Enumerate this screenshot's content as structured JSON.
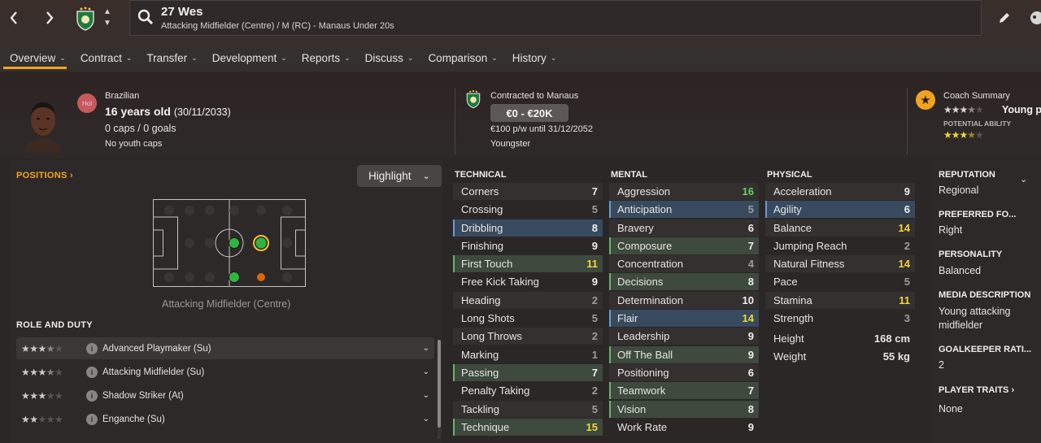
{
  "header": {
    "title": "27 Wes",
    "subtitle": "Attacking Midfielder (Centre) / M (RC) - Manaus Under 20s"
  },
  "tabs": [
    {
      "label": "Overview"
    },
    {
      "label": "Contract"
    },
    {
      "label": "Transfer"
    },
    {
      "label": "Development"
    },
    {
      "label": "Reports"
    },
    {
      "label": "Discuss"
    },
    {
      "label": "Comparison"
    },
    {
      "label": "History"
    }
  ],
  "profile": {
    "position_badge": "Hol",
    "nationality": "Brazilian",
    "age": "16 years old",
    "dob": "(30/11/2033)",
    "caps": "0 caps / 0 goals",
    "youth_caps": "No youth caps"
  },
  "contract": {
    "club": "Contracted to Manaus",
    "value": "€0 - €20K",
    "wage": "€100 p/w until 31/12/2052",
    "status": "Youngster"
  },
  "coach": {
    "label": "Coach Summary",
    "current_stars": 3.5,
    "summary_text": "Young p",
    "potential_label": "POTENTIAL ABILITY",
    "potential_stars": 3.5
  },
  "positions": {
    "heading": "POSITIONS",
    "highlight_label": "Highlight",
    "position_name": "Attacking Midfielder (Centre)"
  },
  "roles": {
    "heading": "ROLE AND DUTY",
    "items": [
      {
        "name": "Advanced Playmaker (Su)",
        "stars": 3.5
      },
      {
        "name": "Attacking Midfielder (Su)",
        "stars": 3.5
      },
      {
        "name": "Shadow Striker (At)",
        "stars": 3
      },
      {
        "name": "Enganche (Su)",
        "stars": 2
      }
    ]
  },
  "technical": {
    "heading": "TECHNICAL",
    "items": [
      {
        "name": "Corners",
        "value": "7"
      },
      {
        "name": "Crossing",
        "value": "5"
      },
      {
        "name": "Dribbling",
        "value": "8"
      },
      {
        "name": "Finishing",
        "value": "9"
      },
      {
        "name": "First Touch",
        "value": "11"
      },
      {
        "name": "Free Kick Taking",
        "value": "9"
      },
      {
        "name": "Heading",
        "value": "2"
      },
      {
        "name": "Long Shots",
        "value": "5"
      },
      {
        "name": "Long Throws",
        "value": "2"
      },
      {
        "name": "Marking",
        "value": "1"
      },
      {
        "name": "Passing",
        "value": "7"
      },
      {
        "name": "Penalty Taking",
        "value": "2"
      },
      {
        "name": "Tackling",
        "value": "5"
      },
      {
        "name": "Technique",
        "value": "15"
      }
    ]
  },
  "mental": {
    "heading": "MENTAL",
    "items": [
      {
        "name": "Aggression",
        "value": "16"
      },
      {
        "name": "Anticipation",
        "value": "5"
      },
      {
        "name": "Bravery",
        "value": "6"
      },
      {
        "name": "Composure",
        "value": "7"
      },
      {
        "name": "Concentration",
        "value": "4"
      },
      {
        "name": "Decisions",
        "value": "8"
      },
      {
        "name": "Determination",
        "value": "10"
      },
      {
        "name": "Flair",
        "value": "14"
      },
      {
        "name": "Leadership",
        "value": "9"
      },
      {
        "name": "Off The Ball",
        "value": "9"
      },
      {
        "name": "Positioning",
        "value": "6"
      },
      {
        "name": "Teamwork",
        "value": "7"
      },
      {
        "name": "Vision",
        "value": "8"
      },
      {
        "name": "Work Rate",
        "value": "9"
      }
    ]
  },
  "physical": {
    "heading": "PHYSICAL",
    "items": [
      {
        "name": "Acceleration",
        "value": "9"
      },
      {
        "name": "Agility",
        "value": "6"
      },
      {
        "name": "Balance",
        "value": "14"
      },
      {
        "name": "Jumping Reach",
        "value": "2"
      },
      {
        "name": "Natural Fitness",
        "value": "14"
      },
      {
        "name": "Pace",
        "value": "5"
      },
      {
        "name": "Stamina",
        "value": "11"
      },
      {
        "name": "Strength",
        "value": "3"
      }
    ],
    "height_label": "Height",
    "height_value": "168 cm",
    "weight_label": "Weight",
    "weight_value": "55 kg"
  },
  "info": {
    "reputation_label": "REPUTATION",
    "reputation_value": "Regional",
    "foot_label": "PREFERRED FO...",
    "foot_value": "Right",
    "personality_label": "PERSONALITY",
    "personality_value": "Balanced",
    "media_label": "MEDIA DESCRIPTION",
    "media_value": "Young attacking midfielder",
    "gk_label": "GOALKEEPER RATI...",
    "gk_value": "2",
    "traits_label": "PLAYER TRAITS",
    "traits_value": "None"
  },
  "colors": {
    "accent": "#f3a323",
    "highlight_blue": "#384b5e",
    "highlight_green": "#3d4a3d",
    "value_yellow": "#f1d63a",
    "value_green": "#64d264"
  }
}
